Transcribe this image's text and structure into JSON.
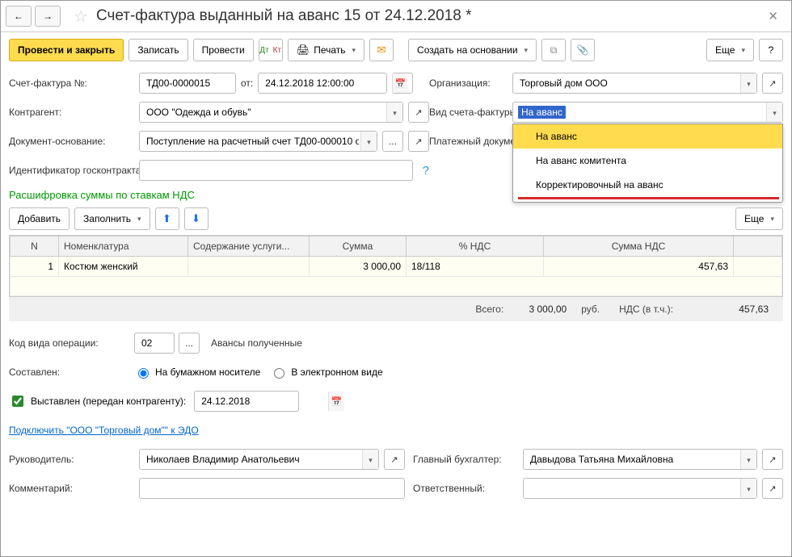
{
  "header": {
    "title": "Счет-фактура выданный на аванс 15 от 24.12.2018 *"
  },
  "toolbar": {
    "save_close": "Провести и закрыть",
    "save": "Записать",
    "post": "Провести",
    "print": "Печать",
    "create_based": "Создать на основании",
    "more": "Еще"
  },
  "form": {
    "number_label": "Счет-фактура №:",
    "number_value": "ТД00-0000015",
    "from_label": "от:",
    "date_value": "24.12.2018 12:00:00",
    "org_label": "Организация:",
    "org_value": "Торговый дом ООО",
    "contragent_label": "Контрагент:",
    "contragent_value": "ООО \"Одежда и обувь\"",
    "invoice_type_label": "Вид счета-фактуры:",
    "invoice_type_selected": "На аванс",
    "invoice_type_options": [
      "На аванс",
      "На аванс комитента",
      "Корректировочный на аванс"
    ],
    "basis_label": "Документ-основание:",
    "basis_value": "Поступление на расчетный счет ТД00-000010 о",
    "payment_doc_label": "Платежный документ №:",
    "gov_id_label": "Идентификатор госконтракта:",
    "gov_id_value": ""
  },
  "vat_section": {
    "title": "Расшифровка суммы по ставкам НДС",
    "add": "Добавить",
    "fill": "Заполнить",
    "more": "Еще",
    "columns": {
      "n": "N",
      "item": "Номенклатура",
      "service": "Содержание услуги...",
      "sum": "Сумма",
      "vat_rate": "% НДС",
      "vat_sum": "Сумма НДС"
    },
    "rows": [
      {
        "n": "1",
        "item": "Костюм женский",
        "service": "",
        "sum": "3 000,00",
        "vat_rate": "18/118",
        "vat_sum": "457,63"
      }
    ],
    "totals": {
      "total_label": "Всего:",
      "total_value": "3 000,00",
      "rub": "руб.",
      "vat_label": "НДС (в т.ч.):",
      "vat_value": "457,63"
    }
  },
  "footer": {
    "op_code_label": "Код вида операции:",
    "op_code_value": "02",
    "op_code_desc": "Авансы полученные",
    "composed_label": "Составлен:",
    "composed_paper": "На бумажном носителе",
    "composed_elec": "В электронном виде",
    "issued_label": "Выставлен (передан контрагенту):",
    "issued_date": "24.12.2018",
    "edo_link": "Подключить \"ООО \"Торговый дом\"\" к ЭДО",
    "head_label": "Руководитель:",
    "head_value": "Николаев Владимир Анатольевич",
    "accountant_label": "Главный бухгалтер:",
    "accountant_value": "Давыдова Татьяна Михайловна",
    "comment_label": "Комментарий:",
    "comment_value": "",
    "responsible_label": "Ответственный:",
    "responsible_value": ""
  }
}
